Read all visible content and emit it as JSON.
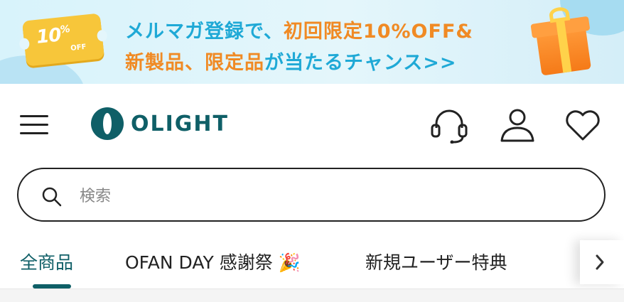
{
  "banner": {
    "coupon_percent": "10",
    "coupon_percent_sign": "%",
    "coupon_off": "OFF",
    "line1_part1": "メルマガ登録で、",
    "line1_part2": "初回限定10%OFF&",
    "line2_part1": "新製品、限定品",
    "line2_part2": "が当たるチャンス>>",
    "colors": {
      "blue": "#1fa9d6",
      "orange": "#f08a24"
    }
  },
  "header": {
    "logo_text": "OLIGHT",
    "icons": [
      "hamburger-menu-icon",
      "headset-icon",
      "user-icon",
      "heart-icon"
    ],
    "brand_color": "#0f5f67"
  },
  "search": {
    "placeholder": "検索",
    "value": ""
  },
  "tabs": {
    "items": [
      {
        "label": "全商品",
        "active": true
      },
      {
        "label": "OFAN DAY 感謝祭 🎉",
        "active": false
      },
      {
        "label": "新規ユーザー特典",
        "active": false
      }
    ]
  }
}
